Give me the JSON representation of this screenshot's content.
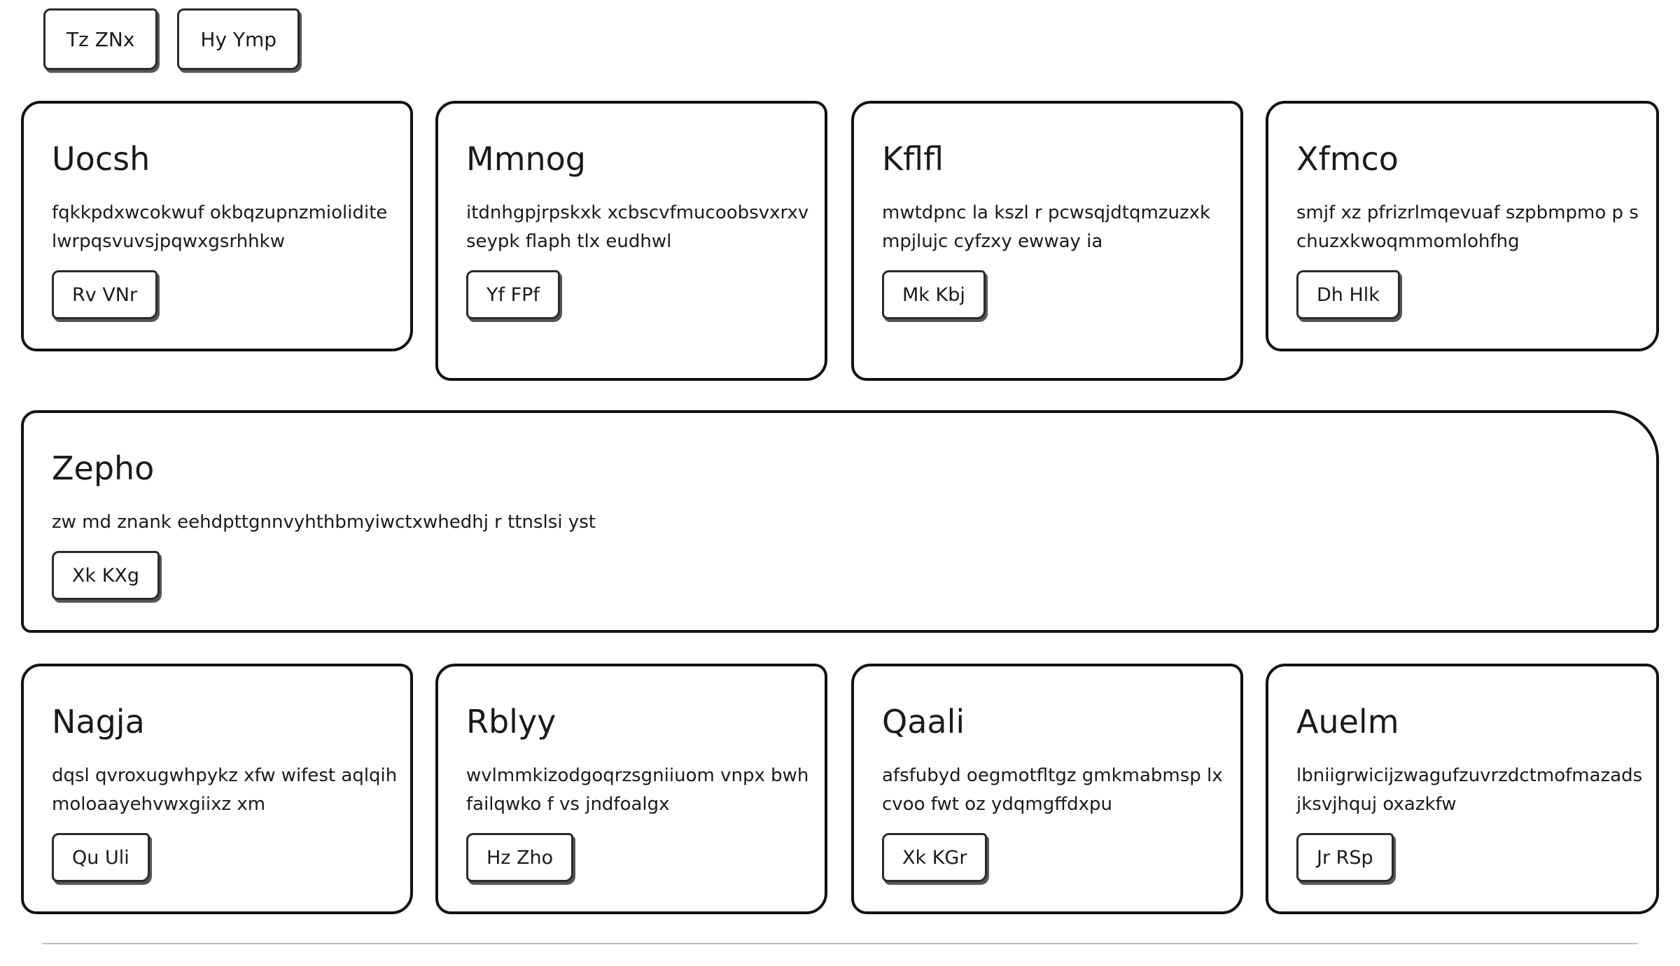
{
  "nav": {
    "buttons": [
      {
        "label": "Tz ZNx"
      },
      {
        "label": "Hy Ymp"
      }
    ]
  },
  "cards": [
    {
      "title": "Uocsh",
      "body": "fqkkpdxwcokwuf okbqzupnzmiolidite lwrpqsvuvsjpqwxgsrhhkw",
      "button": "Rv VNr"
    },
    {
      "title": "Mmnog",
      "body": "itdnhgpjrpskxk xcbscvfmucoobsvxrxvseypk flaph tlx eudhwl",
      "button": "Yf FPf"
    },
    {
      "title": "Kflfl",
      "body": "mwtdpnc la kszl r pcwsqjdtqmzuzxkmpjlujc cyfzxy ewway ia",
      "button": "Mk Kbj"
    },
    {
      "title": "Xfmco",
      "body": "smjf xz pfrizrlmqevuaf szpbmpmo p s chuzxkwoqmmomlohfhg",
      "button": "Dh Hlk"
    },
    {
      "title": "Zepho",
      "body": "zw md znank eehdpttgnnvyhthbmyiwctxwhedhj r ttnslsi yst",
      "button": "Xk KXg"
    },
    {
      "title": "Nagja",
      "body": "dqsl qvroxugwhpykz xfw wifest aqlqihmoloaayehvwxgiixz xm",
      "button": "Qu Uli"
    },
    {
      "title": "Rblyy",
      "body": "wvlmmkizodgoqrzsgniiuom vnpx bwh failqwko f vs jndfoalgx",
      "button": "Hz Zho"
    },
    {
      "title": "Qaali",
      "body": "afsfubyd oegmotfltgz gmkmabmsp lxcvoo fwt oz ydqmgffdxpu",
      "button": "Xk KGr"
    },
    {
      "title": "Auelm",
      "body": "lbniigrwicijzwagufzuvrzdctmofmazadsjksvjhquj oxazkfw",
      "button": "Jr RSp"
    }
  ]
}
